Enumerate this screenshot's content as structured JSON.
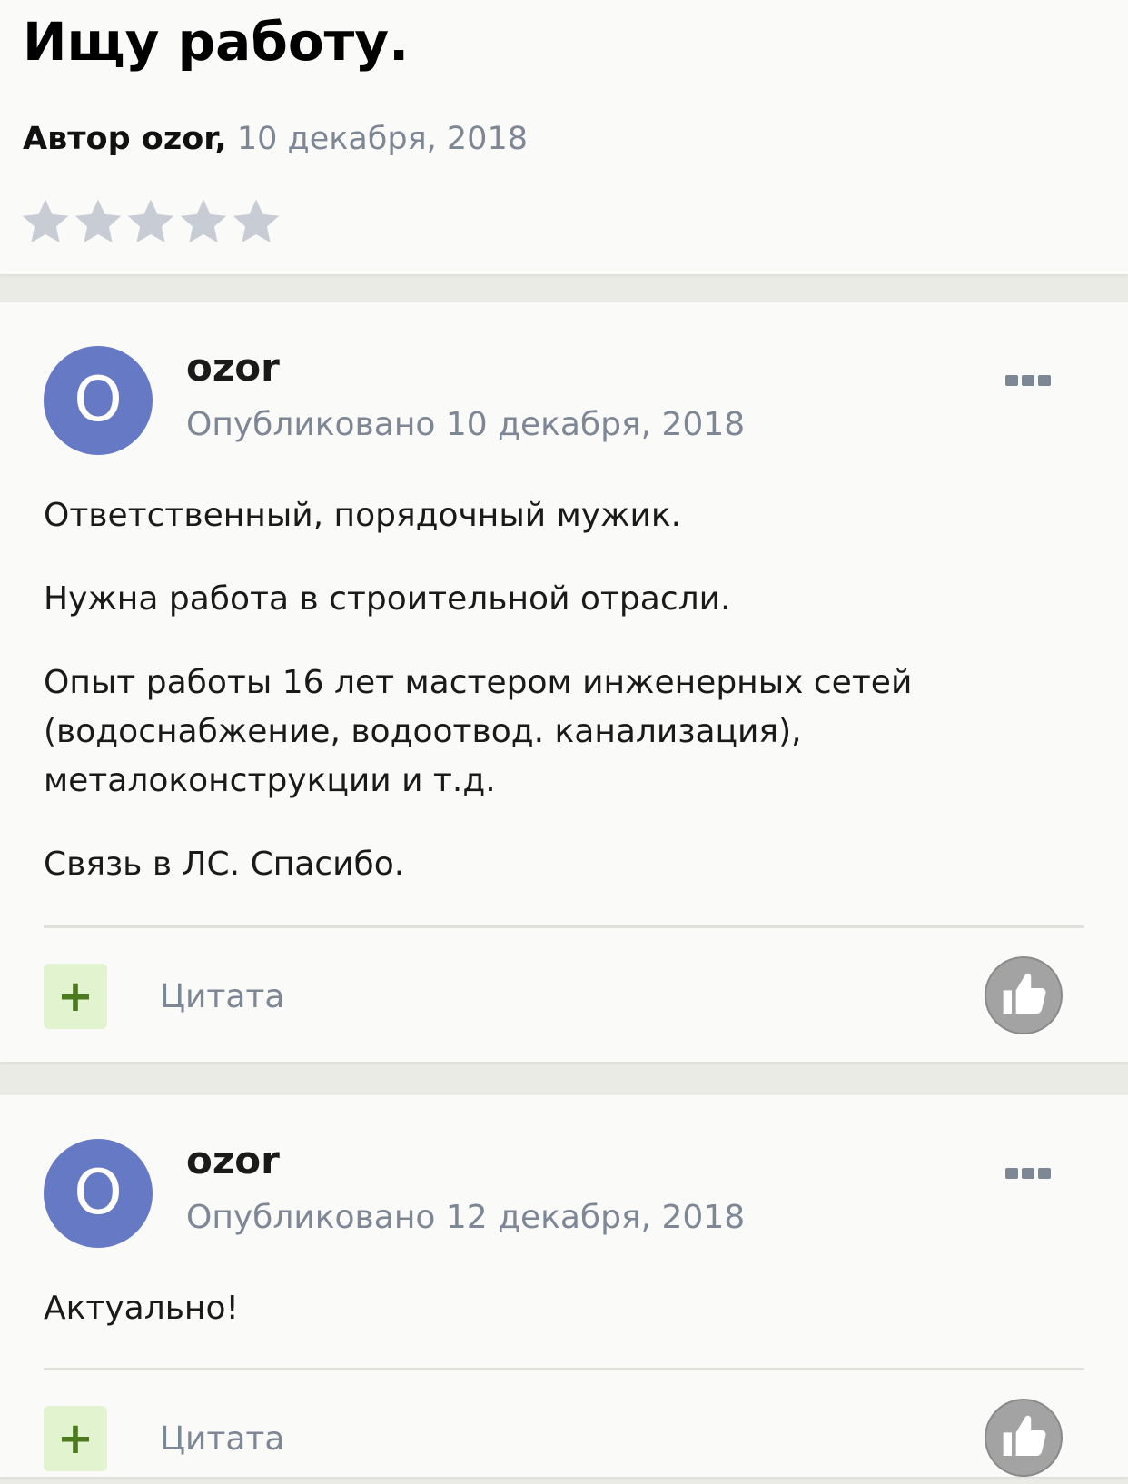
{
  "topic": {
    "title": "Ищу работу.",
    "author_label": "Автор ozor,",
    "date": "10 декабря, 2018",
    "rating": 0,
    "rating_max": 5
  },
  "posts": [
    {
      "avatar_letter": "O",
      "author": "ozor",
      "published": "Опубликовано 10 декабря, 2018",
      "paragraphs": [
        "Ответственный, порядочный мужик.",
        "Нужна работа в строительной отрасли.",
        "Опыт работы 16 лет мастером инженерных сетей (водоснабжение, водоотвод. канализация), металоконструкции и т.д.",
        "Связь в ЛС. Спасибо."
      ],
      "plus_label": "+",
      "quote_label": "Цитата"
    },
    {
      "avatar_letter": "O",
      "author": "ozor",
      "published": "Опубликовано 12 декабря, 2018",
      "paragraphs": [
        "Актуально!"
      ],
      "plus_label": "+",
      "quote_label": "Цитата"
    }
  ],
  "colors": {
    "avatar": "#6679c5",
    "muted_text": "#7d8795",
    "plus_bg": "#e2f3cf",
    "plus_fg": "#4c7a1e",
    "star_empty": "#c8cdd5"
  },
  "icons": {
    "more": "more-options-icon",
    "like": "thumbs-up-icon",
    "star": "star-icon"
  }
}
